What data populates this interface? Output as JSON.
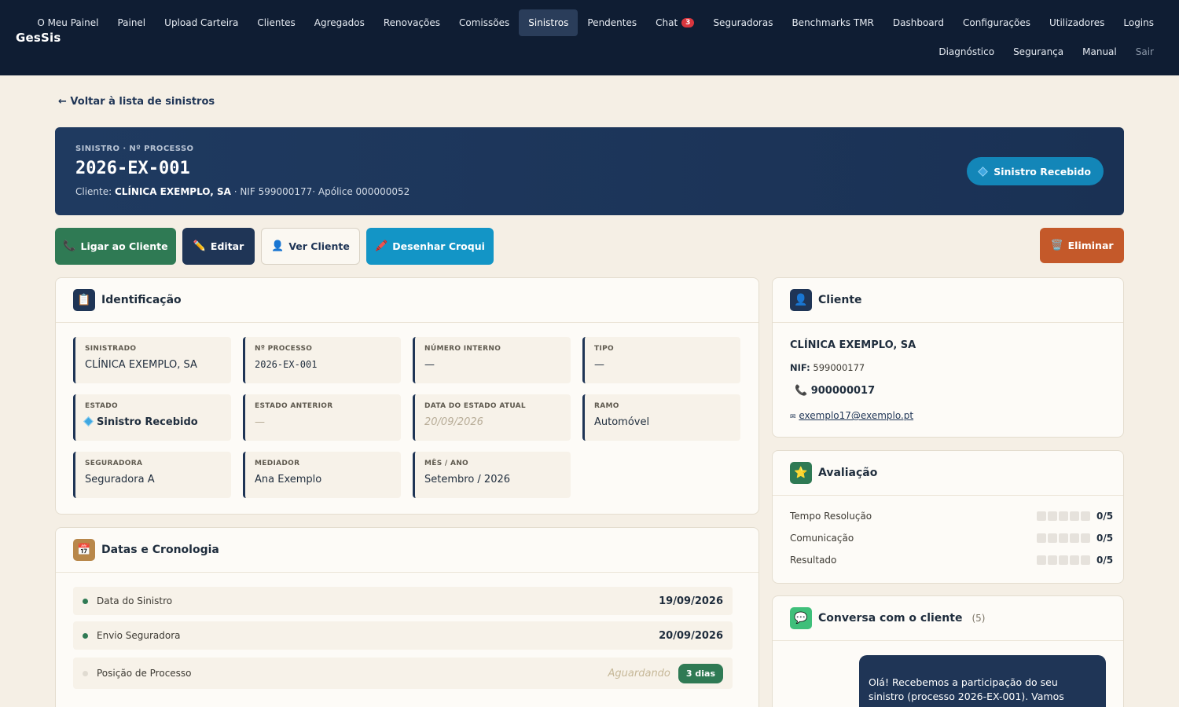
{
  "app": {
    "brand": "GesSis"
  },
  "nav": {
    "row1": [
      {
        "label": "O Meu Painel"
      },
      {
        "label": "Painel"
      },
      {
        "label": "Upload Carteira"
      },
      {
        "label": "Clientes"
      },
      {
        "label": "Agregados"
      },
      {
        "label": "Renovações"
      },
      {
        "label": "Comissões"
      },
      {
        "label": "Sinistros",
        "active": true
      },
      {
        "label": "Pendentes"
      },
      {
        "label": "Chat",
        "badge": "3"
      },
      {
        "label": "Seguradoras"
      },
      {
        "label": "Benchmarks TMR"
      },
      {
        "label": "Dashboard"
      },
      {
        "label": "Configurações"
      },
      {
        "label": "Utilizadores"
      },
      {
        "label": "Logins"
      }
    ],
    "row2": [
      {
        "label": "Diagnóstico"
      },
      {
        "label": "Segurança"
      },
      {
        "label": "Manual"
      },
      {
        "label": "Sair",
        "muted": true
      }
    ]
  },
  "back_link": "← Voltar à lista de sinistros",
  "hero": {
    "kicker": "SINISTRO · Nº PROCESSO",
    "title": "2026-EX-001",
    "client_prefix": "Cliente: ",
    "client_name": "CLÍNICA EXEMPLO, SA",
    "client_suffix": " · NIF 599000177· Apólice 000000052",
    "status_pill": "Sinistro Recebido"
  },
  "actions": {
    "call": "Ligar ao Cliente",
    "edit": "Editar",
    "view_client": "Ver Cliente",
    "draw_sketch": "Desenhar Croqui",
    "delete": "Eliminar"
  },
  "icons": {
    "phone": "📞",
    "pencil": "✏️",
    "person": "👤",
    "pen": "🖍️",
    "trash": "🗑️",
    "clipboard": "📋",
    "calendar": "📅",
    "star": "⭐",
    "chat": "💬",
    "envelope": "✉"
  },
  "identification": {
    "title": "Identificação",
    "fields": [
      {
        "label": "SINISTRADO",
        "value": "CLÍNICA EXEMPLO, SA"
      },
      {
        "label": "Nº PROCESSO",
        "value": "2026-EX-001",
        "mono": true
      },
      {
        "label": "NÚMERO INTERNO",
        "value": "—"
      },
      {
        "label": "TIPO",
        "value": "—"
      },
      {
        "label": "ESTADO",
        "value": "Sinistro Recebido",
        "bold": true,
        "diamond": true
      },
      {
        "label": "ESTADO ANTERIOR",
        "value": "—",
        "muted": true
      },
      {
        "label": "DATA DO ESTADO ATUAL",
        "value": "20/09/2026",
        "muted": true
      },
      {
        "label": "RAMO",
        "value": "Automóvel"
      },
      {
        "label": "SEGURADORA",
        "value": "Seguradora A"
      },
      {
        "label": "MEDIADOR",
        "value": "Ana Exemplo"
      },
      {
        "label": "MÊS / ANO",
        "value": "Setembro / 2026"
      }
    ]
  },
  "dates": {
    "title": "Datas e Cronologia",
    "rows": [
      {
        "label": "Data do Sinistro",
        "value": "19/09/2026",
        "done": true
      },
      {
        "label": "Envio Seguradora",
        "value": "20/09/2026",
        "done": true
      },
      {
        "label": "Posição de Processo",
        "waiting": "Aguardando",
        "badge": "3 dias",
        "done": false
      }
    ]
  },
  "client": {
    "title": "Cliente",
    "name": "CLÍNICA EXEMPLO, SA",
    "nif_label": "NIF:",
    "nif": " 599000177",
    "phone": "900000017",
    "email": "exemplo17@exemplo.pt"
  },
  "evaluation": {
    "title": "Avaliação",
    "rows": [
      {
        "label": "Tempo Resolução",
        "score": "0/5",
        "stars": 0
      },
      {
        "label": "Comunicação",
        "score": "0/5",
        "stars": 0
      },
      {
        "label": "Resultado",
        "score": "0/5",
        "stars": 0
      }
    ]
  },
  "chat": {
    "title": "Conversa com o cliente",
    "count": "(5)",
    "message": "Olá! Recebemos a participação do seu sinistro (processo 2026-EX-001). Vamos"
  },
  "colors": {
    "nav_bg": "#0f1d33",
    "page_bg": "#f5efe5",
    "primary": "#1f3556",
    "green": "#2f7a54",
    "cyan": "#1395c6",
    "orange": "#c4592a",
    "badge_red": "#d9363e"
  }
}
